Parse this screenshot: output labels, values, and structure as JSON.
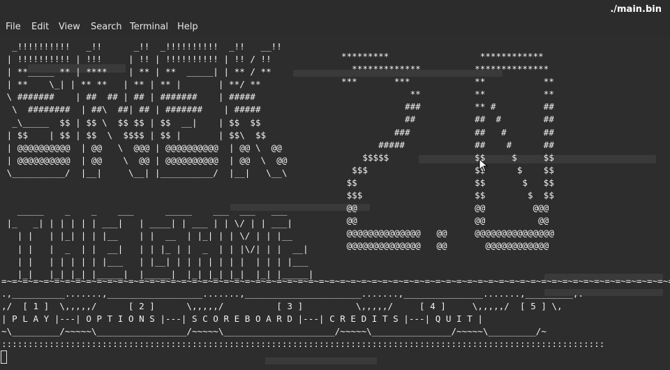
{
  "window": {
    "title": "./main.bin"
  },
  "menu": {
    "items": [
      {
        "label": "File"
      },
      {
        "label": "Edit"
      },
      {
        "label": "View"
      },
      {
        "label": "Search"
      },
      {
        "label": "Terminal"
      },
      {
        "label": "Help"
      }
    ]
  },
  "terminal": {
    "logo_left": "  _!!!!!!!!!!   _!!      _!!  _!!!!!!!!!!  _!!   __!!\n | !!!!!!!!!! | !!!     | !! | !!!!!!!!!! | !! / !!\n | **_____ ** | ****    | ** | **  _____| | ** / **\n | **    \\_| | ** **   | ** | ** |       | **/ **\n \\ #######    | ##  ## | ## | #######    | #####\n  \\  ########  | ##\\  ##| ## | #######    | #####\n  _\\_____  $$ | $$ \\  $$ $$ | $$  __|    | $$  $$\n | $$    | $$ | $$  \\  $$$$ | $$ |       | $$\\  $$\n | @@@@@@@@@@  | @@   \\  @@@ | @@@@@@@@@@  | @@ \\  @@\n | @@@@@@@@@@  | @@    \\  @@ | @@@@@@@@@@  | @@  \\  @@\n \\__________/  |__|     \\__| |__________/  |__|   \\__\\\n\n\n   _____    _    _    ___      _____    ___  ___   ___\n |_   _| | | | | | ___|   | ____| | ___ | | \\/ | | ___|\n   | |   | |_| | | |__    | |  __  | |_| | | \\/ | | |__\n   | |   |  _  | |  __|   | | |_ | |  _  | | |\\/| | |  __|\n   | |   | | | | | |___   | |__| | | | | | | |  | | | |___\n   |_|   |_| |_| |_____|  |_____|  |_| |_| |_|  |_| |_____|",
    "logo_z": "*********\n  *************\n***       ***\n             **\n            ###\n            ##\n          ###\n       #####\n    $$$$$\n  $$$\n $$\n $$$\n @@\n @@\n @@@@@@@@@@@@@@   @@\n @@@@@@@@@@@@@@   @@",
    "logo_d": "   ************\n  **************\n  **           **\n  **           **\n  ** #         ##\n  ##  #        ##\n  ##   #       ##\n  ##    #      ##\n  $$     $     $$\n  $$      $    $$\n  $$       $   $$\n  $$        $  $$\n  @@         @@@\n  @@          @@\n  @@@@@@@@@@@@@@@\n    @@@@@@@@@@@@",
    "menu_art": "=~=~=~=~=~=~=~=~=~=~=~=~=~=~=~=~=~=~=~=~=~=~=~=~=~=~=~=~=~=~=~=~=~=~=~=~=~=~=~=~=~=~=~=~=~=~=~=~=~=~=~=~=~=~=~=~=~=~=~=~=~=~=~=~=~=~=~=~=~=~=~=~=~=~=~=~=~=~=~=~=~=~=~=~=~=~=~=~=~=~=~=~=~=~=~=~=~=~=~=~=~=~=~=~=~=~=~=~=~=~=~=~=~\n.,__________.......,__________________.......,______________________.......,_______________.......,_________,.\n,/  [ 1 ]  \\,,,,,/      [ 2 ]      \\,,,,,/          [ 3 ]          \\,,,,,/     [ 4 ]     \\,,,,,/  [ 5 ] \\,\n| P L A Y |---| O P T I O N S |---| S C O R E B O A R D |---| C R E D I T S |---| Q U I T |\n~\\_________/~~~~~\\_________________/~~~~~\\_____________________/~~~~~\\_______________/~~~~~\\_________/~\n::::::::::::::::::::::::::::::::::::::::::::::::::::::::::::::::::::::::::::::::::::::::::::::::::::::::::::::::::"
  }
}
